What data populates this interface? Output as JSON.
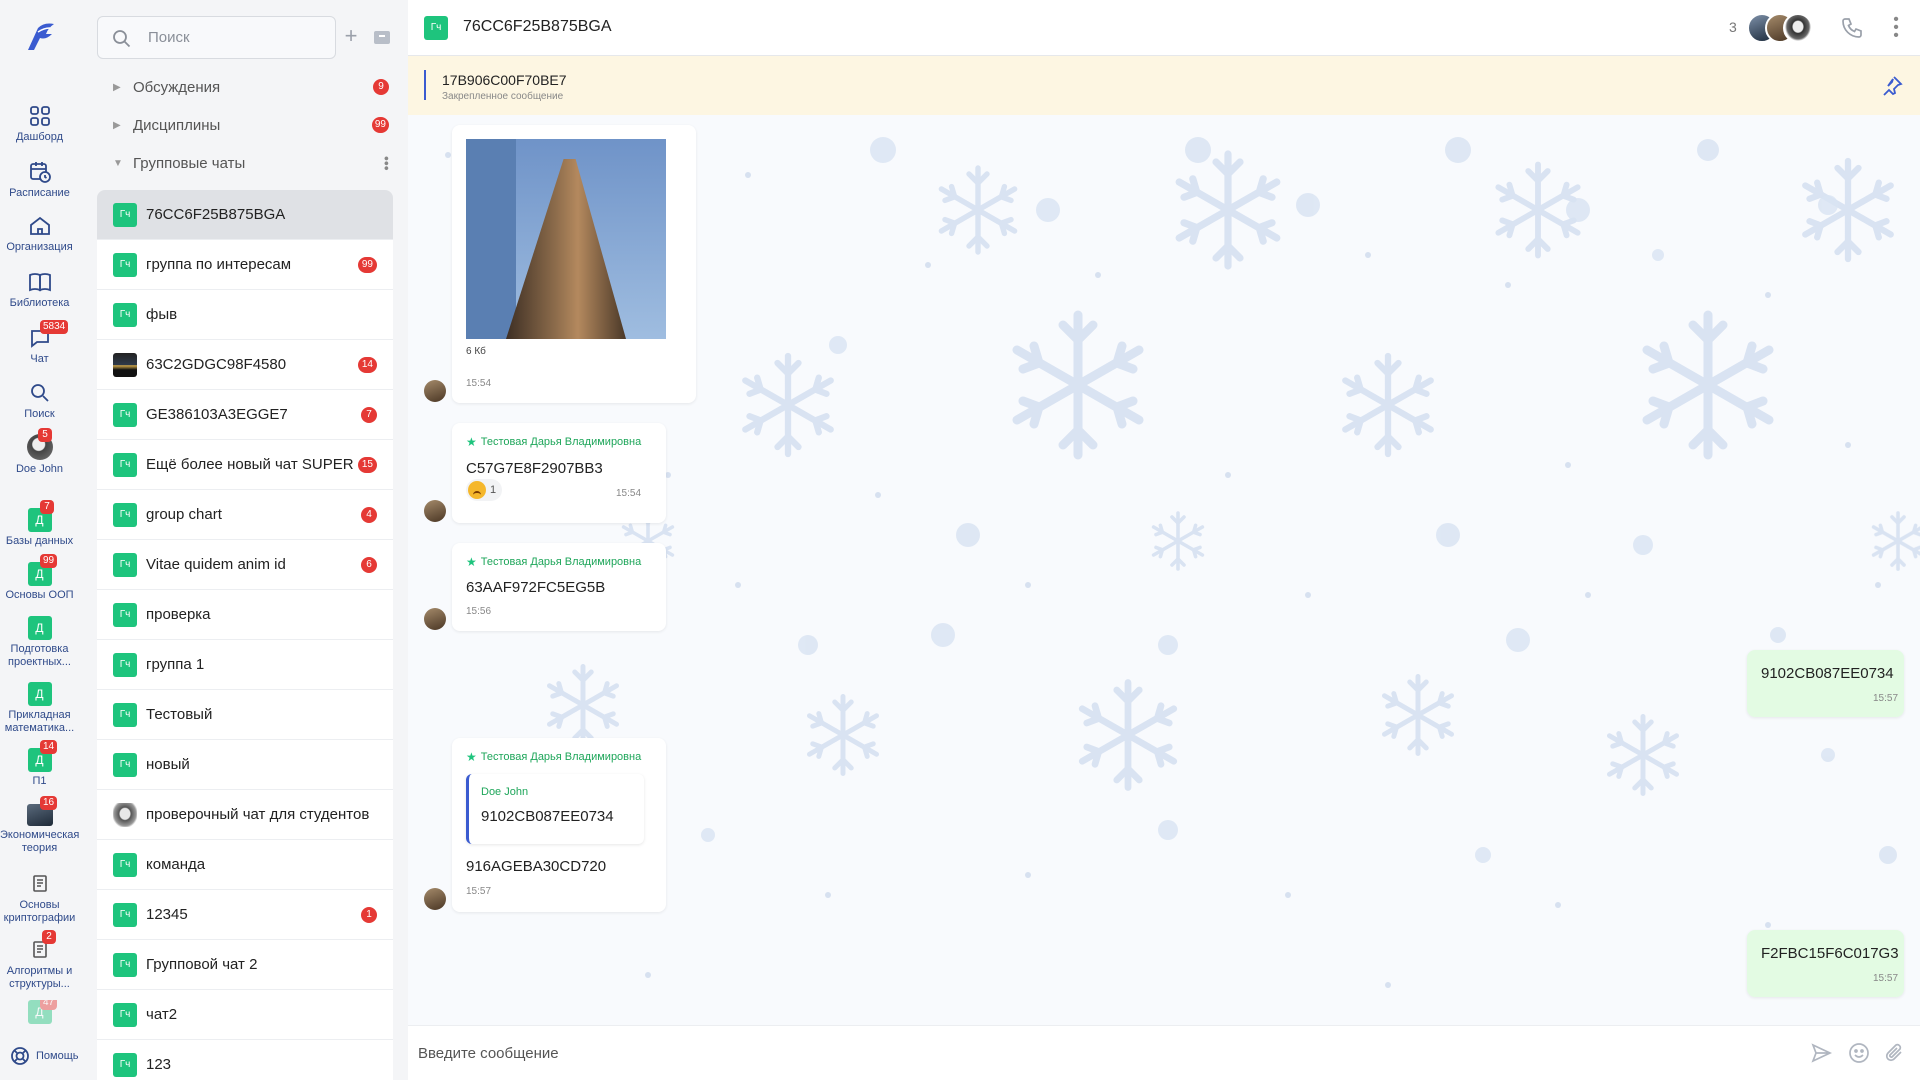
{
  "rail": {
    "items": [
      {
        "label": "Дашборд",
        "icon": "grid-icon"
      },
      {
        "label": "Расписание",
        "icon": "calendar-clock-icon"
      },
      {
        "label": "Организация",
        "icon": "building-icon"
      },
      {
        "label": "Библиотека",
        "icon": "book-icon"
      },
      {
        "label": "Чат",
        "icon": "chat-icon",
        "badge": "5834"
      },
      {
        "label": "Поиск",
        "icon": "search-icon"
      },
      {
        "label": "Doe John",
        "icon": "avatar",
        "badge": "5"
      },
      {
        "label": "Базы данных",
        "chip": "Д",
        "badge": "7"
      },
      {
        "label": "Основы ООП",
        "chip": "Д",
        "badge": "99"
      },
      {
        "label": "Подготовка проектных...",
        "chip": "Д"
      },
      {
        "label": "Прикладная математика...",
        "chip": "Д"
      },
      {
        "label": "П1",
        "chip": "Д",
        "badge": "14"
      },
      {
        "label": "Экономическая теория",
        "icon": "photo",
        "badge": "16"
      },
      {
        "label": "Основы криптографии",
        "icon": "document-icon"
      },
      {
        "label": "Алгоритмы и структуры...",
        "icon": "document-icon",
        "badge": "2"
      },
      {
        "label": "",
        "chip": "Д",
        "badge": "47"
      }
    ],
    "help_label": "Помощь"
  },
  "list": {
    "search_placeholder": "Поиск",
    "groups": [
      {
        "label": "Обсуждения",
        "badge": "9"
      },
      {
        "label": "Дисциплины",
        "badge": "99"
      },
      {
        "label": "Групповые чаты",
        "badge": ""
      }
    ],
    "avatar_label": "Гч",
    "chats": [
      {
        "name": "76CC6F25B875BGA",
        "badge": "",
        "avatar": "chip",
        "active": true
      },
      {
        "name": "группа по интересам",
        "badge": "99",
        "avatar": "chip"
      },
      {
        "name": "фыв",
        "badge": "",
        "avatar": "chip"
      },
      {
        "name": "63C2GDGC98F4580",
        "badge": "14",
        "avatar": "photo"
      },
      {
        "name": "GE386103A3EGGE7",
        "badge": "7",
        "avatar": "chip"
      },
      {
        "name": "Ещё более новый чат SUPER",
        "badge": "15",
        "avatar": "chip"
      },
      {
        "name": "group chart",
        "badge": "4",
        "avatar": "chip"
      },
      {
        "name": "Vitae quidem anim id",
        "badge": "6",
        "avatar": "chip"
      },
      {
        "name": "проверка",
        "badge": "",
        "avatar": "chip"
      },
      {
        "name": "группа 1",
        "badge": "",
        "avatar": "chip"
      },
      {
        "name": "Тестовый",
        "badge": "",
        "avatar": "chip"
      },
      {
        "name": "новый",
        "badge": "",
        "avatar": "chip"
      },
      {
        "name": "проверочный чат для студентов",
        "badge": "",
        "avatar": "alien"
      },
      {
        "name": "команда",
        "badge": "",
        "avatar": "chip"
      },
      {
        "name": "12345",
        "badge": "1",
        "avatar": "chip"
      },
      {
        "name": "Групповой чат 2",
        "badge": "",
        "avatar": "chip"
      },
      {
        "name": "чат2",
        "badge": "",
        "avatar": "chip"
      },
      {
        "name": "123",
        "badge": "",
        "avatar": "chip"
      }
    ]
  },
  "conversation": {
    "avatar_label": "Гч",
    "title": "76CC6F25B875BGA",
    "member_count": "3",
    "pinned": {
      "text": "17B906C00F70BE7",
      "caption": "Закрепленное сообщение"
    },
    "messages": {
      "m1": {
        "file_size": "6 Кб",
        "time": "15:54"
      },
      "m2": {
        "sender": "Тестовая Дарья Владимировна",
        "text": "C57G7E8F2907BB3",
        "time": "15:54",
        "reaction_count": "1"
      },
      "m3": {
        "sender": "Тестовая Дарья Владимировна",
        "text": "63AAF972FC5EG5B",
        "time": "15:56"
      },
      "m4": {
        "text": "9102CB087EE0734",
        "time": "15:57"
      },
      "m5": {
        "sender": "Тестовая Дарья Владимировна",
        "reply_name": "Doe John",
        "reply_text": "9102CB087EE0734",
        "text": "916AGEBA30CD720",
        "time": "15:57"
      },
      "m6": {
        "text": "F2FBC15F6C017G3",
        "time": "15:57"
      }
    },
    "composer_placeholder": "Введите сообщение"
  },
  "colors": {
    "accent": "#1ec47d",
    "badge": "#e53935",
    "link_blue": "#2f4a8a",
    "outgoing": "#e3fbe3",
    "pinned_bg": "#fdf6e2"
  }
}
